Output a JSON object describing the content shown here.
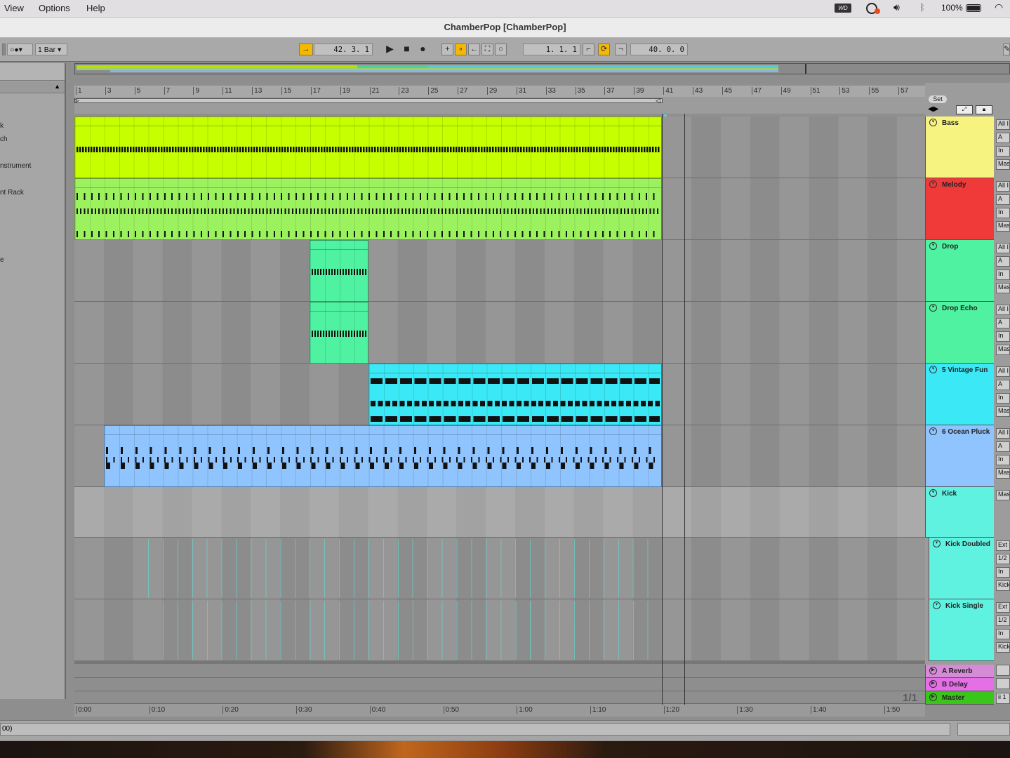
{
  "menubar": {
    "items": [
      "View",
      "Options",
      "Help"
    ],
    "battery": "100%"
  },
  "window": {
    "title": "ChamberPop  [ChamberPop]"
  },
  "control_bar": {
    "quantize": "1 Bar",
    "follow_position": "42.  3.  1",
    "loop_start": "1.  1.  1",
    "loop_length": "40.  0.  0"
  },
  "arrangement": {
    "bar_numbers": [
      "1",
      "3",
      "5",
      "7",
      "9",
      "11",
      "13",
      "15",
      "17",
      "19",
      "21",
      "23",
      "25",
      "27",
      "29",
      "31",
      "33",
      "35",
      "37",
      "39",
      "41",
      "43",
      "45",
      "47",
      "49",
      "51",
      "53",
      "55",
      "57"
    ],
    "time_labels": [
      "0:00",
      "0:10",
      "0:20",
      "0:30",
      "0:40",
      "0:50",
      "1:00",
      "1:10",
      "1:20",
      "1:30",
      "1:40",
      "1:50"
    ],
    "set_button": "Set",
    "page_indicator": "1/1"
  },
  "browser": {
    "items": [
      "k",
      "ch",
      "nstrument",
      "nt Rack",
      "e"
    ]
  },
  "tracks": [
    {
      "name": "Bass",
      "color": "#f7f380",
      "clip_color": "#c5ff00",
      "io": [
        "All I",
        "A",
        "In",
        "Mas"
      ]
    },
    {
      "name": "Melody",
      "color": "#f03a3a",
      "clip_color": "#9cf25e",
      "io": [
        "All I",
        "A",
        "In",
        "Mas"
      ]
    },
    {
      "name": "Drop",
      "color": "#4ff2a0",
      "clip_color": "#4ff2a0",
      "io": [
        "All I",
        "A",
        "In",
        "Mas"
      ]
    },
    {
      "name": "Drop Echo",
      "color": "#4ff2a0",
      "clip_color": "#4ff2a0",
      "io": [
        "All I",
        "A",
        "In",
        "Mas"
      ]
    },
    {
      "name": "5 Vintage Fun",
      "color": "#3be8f5",
      "clip_color": "#3be8f5",
      "io": [
        "All I",
        "A",
        "In",
        "Mas"
      ]
    },
    {
      "name": "6 Ocean Pluck",
      "color": "#8fc4ff",
      "clip_color": "#8fc4ff",
      "io": [
        "All I",
        "A",
        "In",
        "Mas"
      ]
    },
    {
      "name": "Kick",
      "color": "#5ff2e0",
      "io": [
        "Mas"
      ]
    },
    {
      "name": "Kick Doubled",
      "color": "#5ff2e0",
      "io": [
        "Ext",
        "1/2",
        "In",
        "Kick"
      ]
    },
    {
      "name": "Kick Single",
      "color": "#5ff2e0",
      "io": [
        "Ext",
        "1/2",
        "In",
        "Kick"
      ]
    }
  ],
  "returns": [
    {
      "name": "A Reverb",
      "color": "#d58bd6"
    },
    {
      "name": "B Delay",
      "color": "#e56fe6"
    },
    {
      "name": "Master",
      "color": "#39c51a",
      "io": "ii 1"
    }
  ],
  "status": {
    "text": "00)"
  }
}
